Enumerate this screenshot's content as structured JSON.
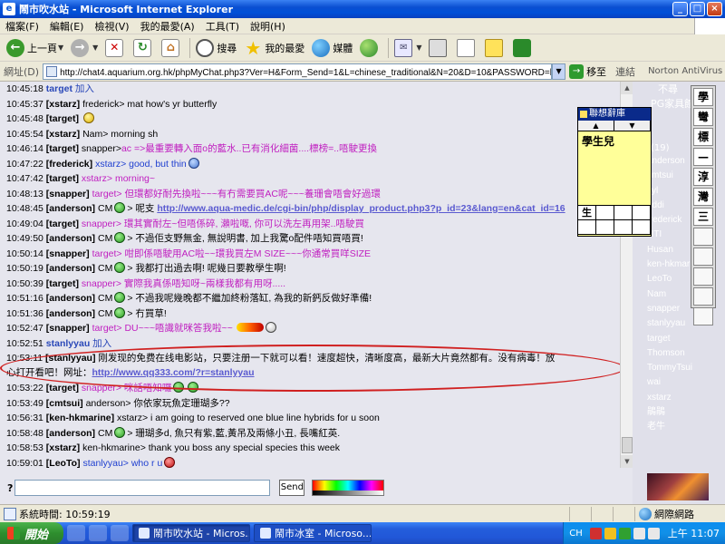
{
  "window": {
    "title": "鬧市吹水站 - Microsoft Internet Explorer",
    "controls": [
      "_",
      "□",
      "×"
    ]
  },
  "menu": [
    "檔案(F)",
    "編輯(E)",
    "檢視(V)",
    "我的最愛(A)",
    "工具(T)",
    "說明(H)"
  ],
  "toolbar": {
    "back": "上一頁",
    "search": "搜尋",
    "favorites": "我的最愛",
    "media": "媒體"
  },
  "address": {
    "label": "網址(D)",
    "url": "http://chat4.aquarium.org.hk/phpMyChat.php3?Ver=H&Form_Send=1&L=chinese_traditional&N=20&D=10&PASSWORD=helo&R0=大房&R1",
    "go": "移至",
    "links": "連結",
    "norton": "Norton AntiVirus"
  },
  "chat": [
    {
      "time": "10:45:18",
      "nick": "target",
      "join": "加入"
    },
    {
      "time": "10:45:37",
      "nick": "[xstarz]",
      "to": "",
      "msg": "frederick> mat how's yr butterfly",
      "color": "black"
    },
    {
      "time": "10:45:48",
      "nick": "[target]",
      "to": "",
      "msg": "",
      "smiley": "yellow"
    },
    {
      "time": "10:45:54",
      "nick": "[xstarz]",
      "to": "",
      "msg": "Nam> morning sh",
      "color": "black"
    },
    {
      "time": "10:46:14",
      "nick": "[target]",
      "to": "snapper>",
      "msg": "ac =>最重要轉入面o的藍水..已有消化細菌....標榜=..唔駛更換",
      "color": "mag"
    },
    {
      "time": "10:47:22",
      "nick": "[frederick]",
      "to": "",
      "msg": "xstarz> good, but thin",
      "color": "blue",
      "smiley": "blue"
    },
    {
      "time": "10:47:42",
      "nick": "[target]",
      "to": "",
      "msg": "xstarz> morning~",
      "color": "mag"
    },
    {
      "time": "10:48:13",
      "nick": "[snapper]",
      "to": "",
      "msg": "target> 但環都好耐先換啦~~~有冇需要買AC呢~~~養珊會唔會好過環",
      "color": "mag"
    },
    {
      "time": "10:48:45",
      "nick": "[anderson]",
      "to": "CM",
      "msg": "> 呢支",
      "link": "http://www.aqua-medic.de/cgi-bin/php/display_product.php3?p_id=23&lang=en&cat_id=16",
      "smiley": "green"
    },
    {
      "time": "10:49:04",
      "nick": "[target]",
      "to": "",
      "msg": "snapper> 環其實耐左~但唔係碎, 瀨啦嘅, 你可以洗左再用架..唔駛買",
      "color": "mag"
    },
    {
      "time": "10:49:50",
      "nick": "[anderson]",
      "to": "CM",
      "msg": "> 不過佢支野無金, 無說明書, 加上我驚o配件唔知買唔買!",
      "smiley": "green"
    },
    {
      "time": "10:50:14",
      "nick": "[snapper]",
      "to": "",
      "msg": "target> 咁即係唔駛用AC啦~~環我買左M SIZE~~~你通常買咩SIZE",
      "color": "mag"
    },
    {
      "time": "10:50:19",
      "nick": "[anderson]",
      "to": "CM",
      "msg": "> 我都打出過去啊! 呢幾日要教學生啊!",
      "smiley": "green"
    },
    {
      "time": "10:50:39",
      "nick": "[target]",
      "to": "",
      "msg": "snapper> 實際我真係唔知呀~兩樣我都有用呀.....",
      "color": "mag"
    },
    {
      "time": "10:51:16",
      "nick": "[anderson]",
      "to": "CM",
      "msg": "> 不過我呢幾晚都不繼加終粉落缸, 為我的新鈣反做好準備!",
      "smiley": "green"
    },
    {
      "time": "10:51:36",
      "nick": "[anderson]",
      "to": "CM",
      "msg": "> 冇買草!",
      "smiley": "green"
    },
    {
      "time": "10:52:47",
      "nick": "[snapper]",
      "to": "",
      "msg": "target> DU~~~唔識就咪答我啦~~",
      "color": "mag",
      "emote": true
    },
    {
      "time": "10:52:51",
      "nick": "stanlyyau",
      "join": "加入"
    },
    {
      "time": "10:53:11",
      "nick": "[stanlyyau]",
      "to": "",
      "msg": "刚发现的免费在线电影站，只要注册一下就可以看！速度超快，清晰度高，最新大片竟然都有。没有病毒！放心打开看吧！网址：",
      "link2": "http://www.qq333.com/?r=stanlyyau",
      "tall": true
    },
    {
      "time": "10:53:22",
      "nick": "[target]",
      "to": "",
      "msg": "snapper> 咪話唔知囉",
      "color": "mag",
      "smiley": "green"
    },
    {
      "time": "10:53:49",
      "nick": "[cmtsui]",
      "to": "",
      "msg": "anderson> 你依家玩魚定珊瑚多??",
      "color": "black"
    },
    {
      "time": "10:56:31",
      "nick": "[ken-hkmarine]",
      "to": "",
      "msg": "xstarz> i am going to reserved one blue line hybrids for u soon",
      "color": "black"
    },
    {
      "time": "10:58:48",
      "nick": "[anderson]",
      "to": "CM",
      "msg": "> 珊瑚多d, 魚只有紫,藍,黃吊及兩條小丑, 長嘴紅英.",
      "smiley": "green"
    },
    {
      "time": "10:58:53",
      "nick": "[xstarz]",
      "to": "",
      "msg": "ken-hkmarine> thank you boss any special species this week",
      "color": "black"
    },
    {
      "time": "10:59:01",
      "nick": "[LeoTo]",
      "to": "",
      "msg": "stanlyyau> who r u",
      "color": "blue",
      "smiley": "red"
    }
  ],
  "users": {
    "header": "不尋",
    "sub": "PG家具館",
    "count": "(19)",
    "names": [
      "anderson",
      "cmtsui",
      "cyl",
      "eddi",
      "frederick",
      "HTI",
      "Husan",
      "ken-hkmarine",
      "LeoTo",
      "Nam",
      "snapper",
      "stanlyyau",
      "target",
      "Thomson",
      "TommyTsui",
      "wai",
      "xstarz",
      "鵑鵑",
      "老牛"
    ]
  },
  "floatbar": [
    "學",
    "彎",
    "標",
    "—",
    "淳",
    "灣",
    "三"
  ],
  "ime": {
    "title": "聯想辭庫",
    "candidate": "學生兒",
    "input": "生"
  },
  "input": {
    "label": "?",
    "send": "Send"
  },
  "status": {
    "text": "系統時間: 10:59:19",
    "zone": "網際網路"
  },
  "taskbar": {
    "start": "開始",
    "tasks": [
      "鬧市吹水站 - Micros...",
      "鬧市冰室 - Microso..."
    ],
    "lang": "CH",
    "clock": "上午 11:07"
  },
  "colors": {
    "titlebar": "#0a4fd1",
    "chat_bg": "#e6e6ee",
    "highlight": "#d02020",
    "target_magenta": "#c020c0"
  }
}
